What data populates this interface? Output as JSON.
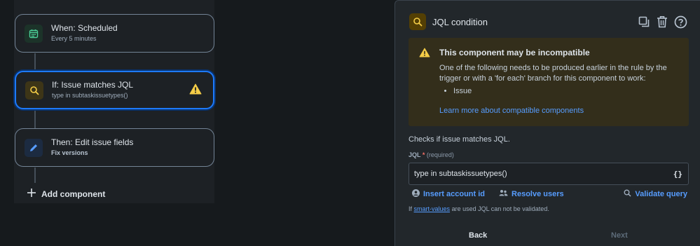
{
  "rule": {
    "nodes": [
      {
        "title": "When: Scheduled",
        "subtitle": "Every 5 minutes",
        "icon": "calendar-icon"
      },
      {
        "title": "If: Issue matches JQL",
        "subtitle": "type in subtaskissuetypes()",
        "icon": "search-icon"
      },
      {
        "title": "Then: Edit issue fields",
        "subtitle": "Fix versions",
        "icon": "pencil-icon"
      }
    ],
    "add_component": "Add component"
  },
  "panel": {
    "title": "JQL condition",
    "warning": {
      "title": "This component may be incompatible",
      "body": "One of the following needs to be produced earlier in the rule by the trigger or with a 'for each' branch for this component to work:",
      "items": [
        "Issue"
      ],
      "link": "Learn more about compatible components"
    },
    "description": "Checks if issue matches JQL.",
    "jql_label": "JQL",
    "required_marker": "*",
    "required_text": "(required)",
    "jql_value": "type in subtaskissuetypes()",
    "braces": "{}",
    "insert_account": "Insert account id",
    "resolve_users": "Resolve users",
    "validate_query": "Validate query",
    "smart_prefix": "If",
    "smart_link": "smart-values",
    "smart_suffix": "are used JQL can not be validated.",
    "back": "Back",
    "next": "Next"
  },
  "colors": {
    "accent": "#1d7afc",
    "link": "#579dff",
    "warning": "#f5cd47"
  }
}
